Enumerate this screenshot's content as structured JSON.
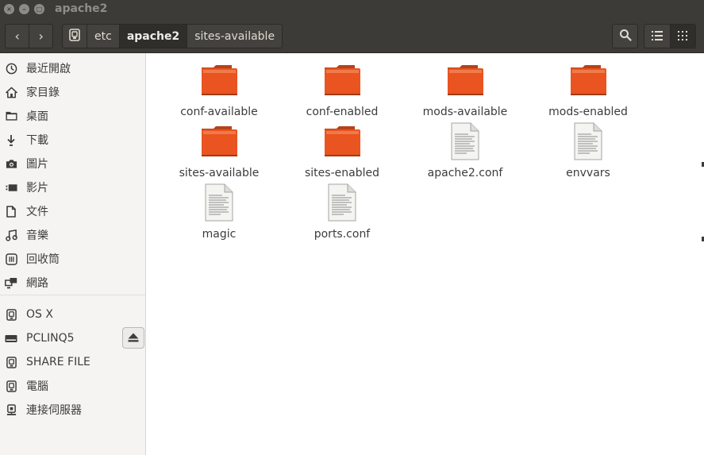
{
  "window": {
    "title": "apache2"
  },
  "window_controls": {
    "close": "×",
    "minimize": "–",
    "maximize": "□"
  },
  "toolbar": {
    "back_icon": "‹",
    "forward_icon": "›",
    "path": [
      {
        "label": ""
      },
      {
        "label": "etc"
      },
      {
        "label": "apache2"
      },
      {
        "label": "sites-available"
      }
    ]
  },
  "sidebar": {
    "places": [
      {
        "label": "最近開啟",
        "icon": "clock-icon"
      },
      {
        "label": "家目錄",
        "icon": "home-icon"
      },
      {
        "label": "桌面",
        "icon": "folder-icon"
      },
      {
        "label": "下載",
        "icon": "download-icon"
      },
      {
        "label": "圖片",
        "icon": "camera-icon"
      },
      {
        "label": "影片",
        "icon": "video-icon"
      },
      {
        "label": "文件",
        "icon": "document-icon"
      },
      {
        "label": "音樂",
        "icon": "music-icon"
      },
      {
        "label": "回收筒",
        "icon": "trash-icon"
      },
      {
        "label": "網路",
        "icon": "network-icon"
      }
    ],
    "devices": [
      {
        "label": "OS X",
        "icon": "drive-icon"
      },
      {
        "label": "PCLINQ5",
        "icon": "disk-icon"
      },
      {
        "label": "SHARE FILE",
        "icon": "drive-icon"
      },
      {
        "label": "電腦",
        "icon": "drive-icon"
      },
      {
        "label": "連接伺服器",
        "icon": "server-icon"
      }
    ]
  },
  "files": [
    {
      "name": "conf-available",
      "type": "folder"
    },
    {
      "name": "conf-enabled",
      "type": "folder"
    },
    {
      "name": "mods-available",
      "type": "folder"
    },
    {
      "name": "mods-enabled",
      "type": "folder"
    },
    {
      "name": "sites-available",
      "type": "folder"
    },
    {
      "name": "sites-enabled",
      "type": "folder"
    },
    {
      "name": "apache2.conf",
      "type": "text"
    },
    {
      "name": "envvars",
      "type": "text"
    },
    {
      "name": "magic",
      "type": "text"
    },
    {
      "name": "ports.conf",
      "type": "text"
    }
  ],
  "colors": {
    "titlebar": "#3c3b37",
    "folder": "#e95420",
    "sidebar": "#f5f4f3"
  }
}
